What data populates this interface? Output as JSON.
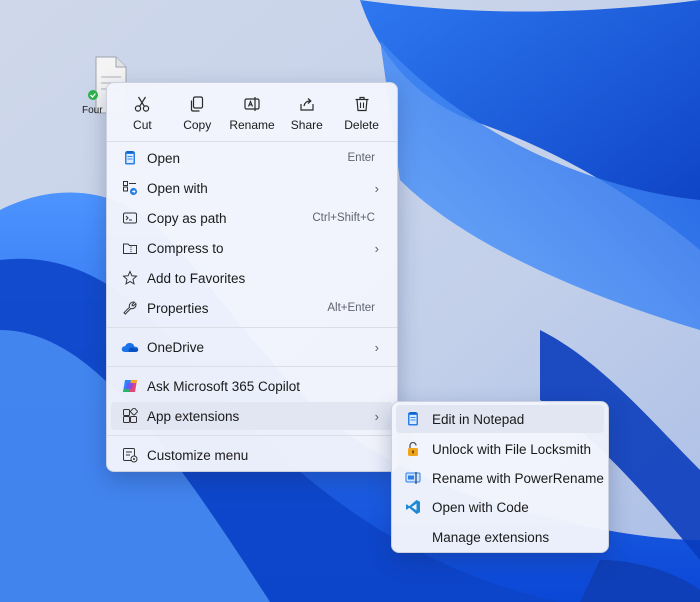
{
  "desktop": {
    "file_label": "Four"
  },
  "quick_actions": [
    {
      "label": "Cut",
      "icon": "cut-icon"
    },
    {
      "label": "Copy",
      "icon": "copy-icon"
    },
    {
      "label": "Rename",
      "icon": "rename-icon"
    },
    {
      "label": "Share",
      "icon": "share-icon"
    },
    {
      "label": "Delete",
      "icon": "delete-icon"
    }
  ],
  "menu": {
    "items": [
      {
        "label": "Open",
        "shortcut": "Enter",
        "icon": "notepad-icon"
      },
      {
        "label": "Open with",
        "submenu": true,
        "icon": "open-with-icon"
      },
      {
        "label": "Copy as path",
        "shortcut": "Ctrl+Shift+C",
        "icon": "copy-path-icon"
      },
      {
        "label": "Compress to",
        "submenu": true,
        "icon": "compress-icon"
      },
      {
        "label": "Add to Favorites",
        "icon": "star-icon"
      },
      {
        "label": "Properties",
        "shortcut": "Alt+Enter",
        "icon": "wrench-icon"
      },
      {
        "label": "OneDrive",
        "submenu": true,
        "icon": "onedrive-icon"
      },
      {
        "label": "Ask Microsoft 365 Copilot",
        "icon": "copilot-icon"
      },
      {
        "label": "App extensions",
        "submenu": true,
        "icon": "app-extensions-icon"
      },
      {
        "label": "Customize menu",
        "icon": "customize-icon"
      }
    ],
    "chevron": "›"
  },
  "submenu": {
    "items": [
      {
        "label": "Edit in Notepad",
        "icon": "notepad-icon"
      },
      {
        "label": "Unlock with File Locksmith",
        "icon": "lock-icon"
      },
      {
        "label": "Rename with PowerRename",
        "icon": "powerrename-icon"
      },
      {
        "label": "Open with Code",
        "icon": "vscode-icon"
      },
      {
        "label": "Manage extensions",
        "icon": ""
      }
    ]
  },
  "colors": {
    "accent": "#1f6fe8",
    "wallpaper_light": "#d9e2f3",
    "wallpaper_blue": "#1757d9"
  }
}
